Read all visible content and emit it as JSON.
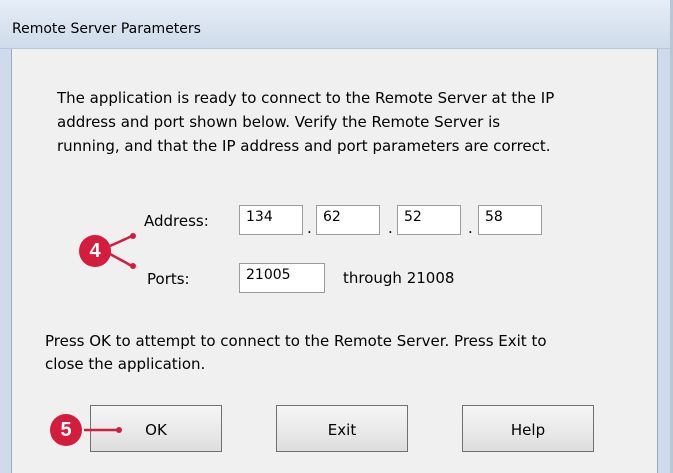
{
  "window": {
    "title": "Remote Server Parameters"
  },
  "message": {
    "instructions": "The application is ready to connect to the Remote Server at the IP\naddress and port shown below.  Verify the Remote Server is\nrunning, and that the IP address and port parameters are correct.",
    "footer": "Press OK to attempt to connect to the Remote Server. Press Exit to\nclose the application."
  },
  "address": {
    "label": "Address:",
    "octets": [
      "134",
      "62",
      "52",
      "58"
    ],
    "separator": "."
  },
  "ports": {
    "label": "Ports:",
    "start": "21005",
    "range_text": "through 21008"
  },
  "buttons": {
    "ok": "OK",
    "exit": "Exit",
    "help": "Help"
  },
  "callouts": {
    "address_ports": "4",
    "ok_button": "5",
    "color": "#d41c3c"
  }
}
